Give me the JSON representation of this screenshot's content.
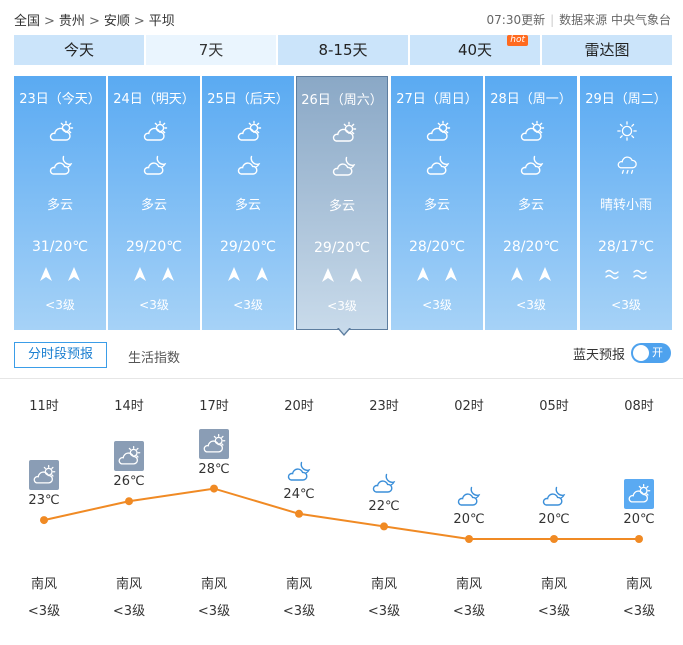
{
  "breadcrumb": [
    "全国",
    "贵州",
    "安顺",
    "平坝"
  ],
  "update": {
    "time": "07:30更新",
    "source": "数据来源 中央气象台"
  },
  "tabs": [
    {
      "label": "今天",
      "active": false
    },
    {
      "label": "7天",
      "active": true
    },
    {
      "label": "8-15天",
      "active": false
    },
    {
      "label": "40天",
      "active": false,
      "badge": "hot"
    },
    {
      "label": "雷达图",
      "active": false
    }
  ],
  "days": [
    {
      "date": "23日（今天）",
      "icon_day": "partly-cloudy-icon",
      "icon_night": "cloudy-moon-icon",
      "desc": "多云",
      "temp": "31/20℃",
      "wind_icon": "arrow-up-icon",
      "level": "<3级"
    },
    {
      "date": "24日（明天）",
      "icon_day": "partly-cloudy-icon",
      "icon_night": "cloudy-moon-icon",
      "desc": "多云",
      "temp": "29/20℃",
      "wind_icon": "arrow-up-icon",
      "level": "<3级"
    },
    {
      "date": "25日（后天）",
      "icon_day": "partly-cloudy-icon",
      "icon_night": "cloudy-moon-icon",
      "desc": "多云",
      "temp": "29/20℃",
      "wind_icon": "arrow-up-icon",
      "level": "<3级"
    },
    {
      "date": "26日（周六）",
      "icon_day": "partly-cloudy-icon",
      "icon_night": "cloudy-moon-icon",
      "desc": "多云",
      "temp": "29/20℃",
      "wind_icon": "arrow-up-icon",
      "level": "<3级",
      "active": true
    },
    {
      "date": "27日（周日）",
      "icon_day": "partly-cloudy-icon",
      "icon_night": "cloudy-moon-icon",
      "desc": "多云",
      "temp": "28/20℃",
      "wind_icon": "arrow-up-icon",
      "level": "<3级"
    },
    {
      "date": "28日（周一）",
      "icon_day": "partly-cloudy-icon",
      "icon_night": "cloudy-moon-icon",
      "desc": "多云",
      "temp": "28/20℃",
      "wind_icon": "arrow-up-icon",
      "level": "<3级"
    },
    {
      "date": "29日（周二）",
      "icon_day": "sun-icon",
      "icon_night": "rain-icon",
      "desc": "晴转小雨",
      "temp": "28/17℃",
      "wind_icon": "wave-icon",
      "level": "<3级"
    }
  ],
  "subtabs": {
    "hourly": "分时段预报",
    "life": "生活指数"
  },
  "bluesky": {
    "label": "蓝天预报",
    "toggle": "开"
  },
  "hourly": [
    {
      "time": "11时",
      "temp": "23℃",
      "value": 23,
      "icon": "partly-cloudy-icon",
      "wind": "南风",
      "level": "<3级"
    },
    {
      "time": "14时",
      "temp": "26℃",
      "value": 26,
      "icon": "partly-cloudy-icon",
      "wind": "南风",
      "level": "<3级"
    },
    {
      "time": "17时",
      "temp": "28℃",
      "value": 28,
      "icon": "partly-cloudy-icon",
      "wind": "南风",
      "level": "<3级"
    },
    {
      "time": "20时",
      "temp": "24℃",
      "value": 24,
      "icon": "cloudy-moon-icon",
      "wind": "南风",
      "level": "<3级"
    },
    {
      "time": "23时",
      "temp": "22℃",
      "value": 22,
      "icon": "cloudy-moon-icon",
      "wind": "南风",
      "level": "<3级"
    },
    {
      "time": "02时",
      "temp": "20℃",
      "value": 20,
      "icon": "cloudy-moon-icon",
      "wind": "南风",
      "level": "<3级"
    },
    {
      "time": "05时",
      "temp": "20℃",
      "value": 20,
      "icon": "cloudy-moon-icon",
      "wind": "南风",
      "level": "<3级"
    },
    {
      "time": "08时",
      "temp": "20℃",
      "value": 20,
      "icon": "partly-cloudy-icon",
      "wind": "南风",
      "level": "<3级"
    }
  ],
  "colors": {
    "accent": "#4ea2ee",
    "line": "#f08a24",
    "card_top": "#5aaaf2",
    "card_bottom": "#a6d2f7",
    "hot": "#ff6a1f"
  }
}
